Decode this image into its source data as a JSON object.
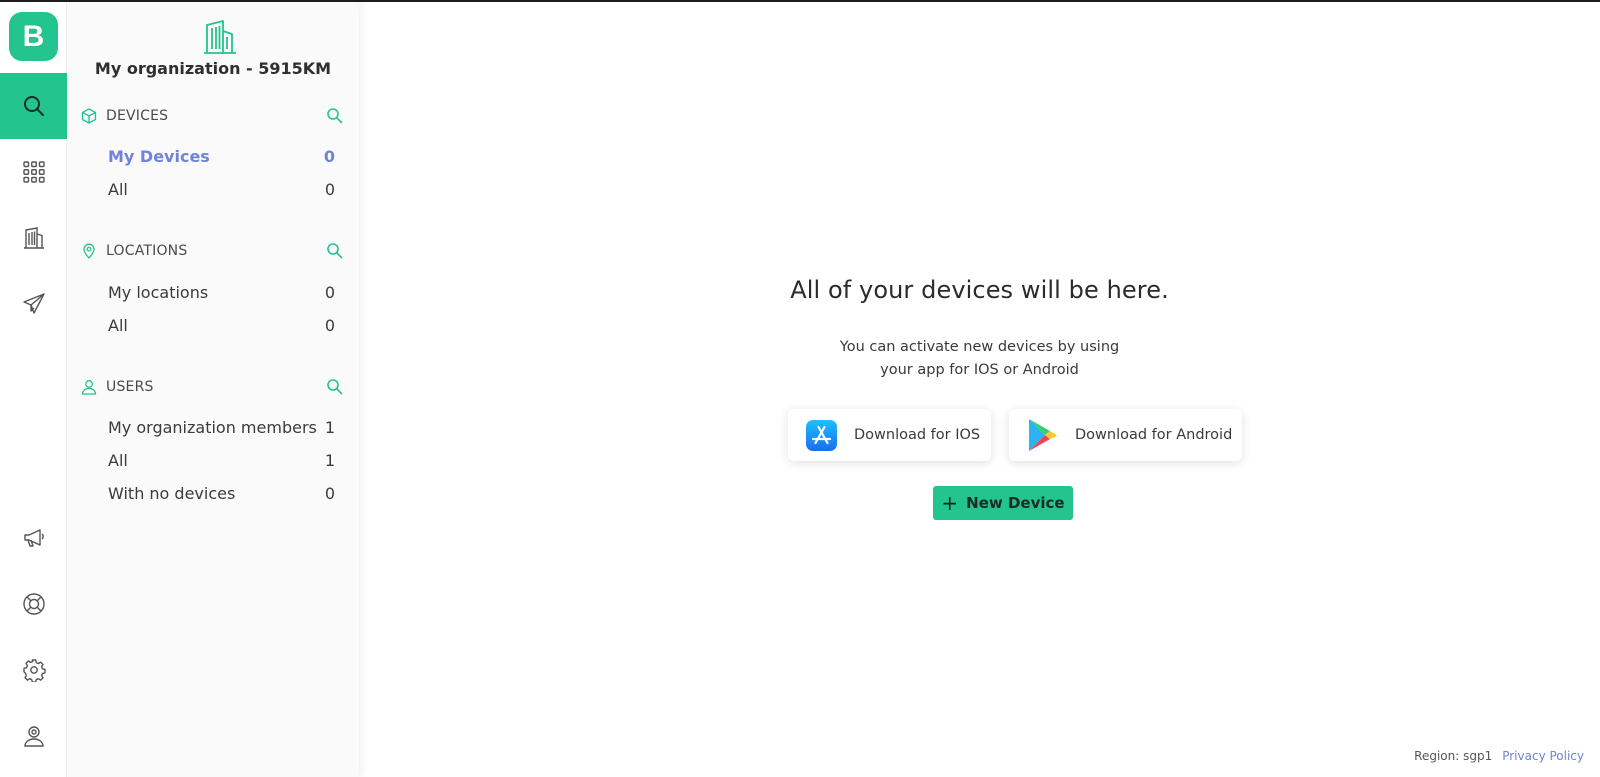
{
  "app": {
    "logo_letter": "B",
    "accent_color": "#23c48e",
    "link_color": "#6f83d9"
  },
  "rail": {
    "top_items": [
      {
        "name": "search-icon",
        "active": true
      },
      {
        "name": "apps-grid-icon",
        "active": false
      },
      {
        "name": "building-icon",
        "active": false
      },
      {
        "name": "paper-plane-icon",
        "active": false
      }
    ],
    "bottom_items": [
      {
        "name": "megaphone-icon"
      },
      {
        "name": "lifebuoy-icon"
      },
      {
        "name": "gear-icon"
      },
      {
        "name": "user-profile-icon"
      }
    ]
  },
  "sidebar": {
    "org_name": "My organization - 5915KM",
    "sections": [
      {
        "title": "DEVICES",
        "icon": "cube-icon",
        "items": [
          {
            "label": "My Devices",
            "count": "0",
            "active": true
          },
          {
            "label": "All",
            "count": "0",
            "active": false
          }
        ]
      },
      {
        "title": "LOCATIONS",
        "icon": "location-pin-icon",
        "items": [
          {
            "label": "My locations",
            "count": "0",
            "active": false
          },
          {
            "label": "All",
            "count": "0",
            "active": false
          }
        ]
      },
      {
        "title": "USERS",
        "icon": "user-icon",
        "items": [
          {
            "label": "My organization members",
            "count": "1",
            "active": false
          },
          {
            "label": "All",
            "count": "1",
            "active": false
          },
          {
            "label": "With no devices",
            "count": "0",
            "active": false
          }
        ]
      }
    ]
  },
  "main": {
    "headline": "All of your devices will be here.",
    "subline_1": "You can activate new devices by using",
    "subline_2": "your app for IOS or Android",
    "ios_button": "Download for IOS",
    "android_button": "Download for Android",
    "new_device_button": "New Device",
    "new_device_plus": "+"
  },
  "footer": {
    "region": "Region: sgp1",
    "privacy": "Privacy Policy"
  }
}
